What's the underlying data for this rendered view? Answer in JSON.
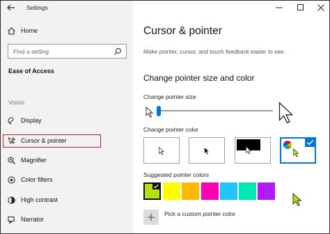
{
  "window": {
    "title": "Settings"
  },
  "sidebar": {
    "home_label": "Home",
    "search_placeholder": "Find a setting",
    "section_title": "Ease of Access",
    "group_title": "Vision",
    "items": [
      {
        "label": "Display",
        "icon": "display-icon"
      },
      {
        "label": "Cursor & pointer",
        "icon": "cursor-pointer-icon",
        "selected": true
      },
      {
        "label": "Magnifier",
        "icon": "magnifier-icon"
      },
      {
        "label": "Color filters",
        "icon": "color-filter-icon"
      },
      {
        "label": "High contrast",
        "icon": "high-contrast-icon"
      },
      {
        "label": "Narrator",
        "icon": "narrator-icon"
      }
    ]
  },
  "main": {
    "title": "Cursor & pointer",
    "description": "Make pointer, cursor, and touch feedback easier to see.",
    "pointer_section_title": "Change pointer size and color",
    "size_label": "Change pointer size",
    "size_value": 0.0,
    "color_label": "Change pointer color",
    "color_options": [
      {
        "name": "white",
        "selected": false
      },
      {
        "name": "black",
        "selected": false
      },
      {
        "name": "inverted",
        "selected": false
      },
      {
        "name": "custom",
        "selected": true
      }
    ],
    "suggested_label": "Suggested pointer colors",
    "suggested_colors": [
      "#b7e10d",
      "#ffff00",
      "#ffb900",
      "#ff00b3",
      "#20c5ff",
      "#00e6b5",
      "#b31bff"
    ],
    "suggested_selected_index": 0,
    "custom_label": "Pick a custom pointer color",
    "accent_color": "#0078d7"
  }
}
